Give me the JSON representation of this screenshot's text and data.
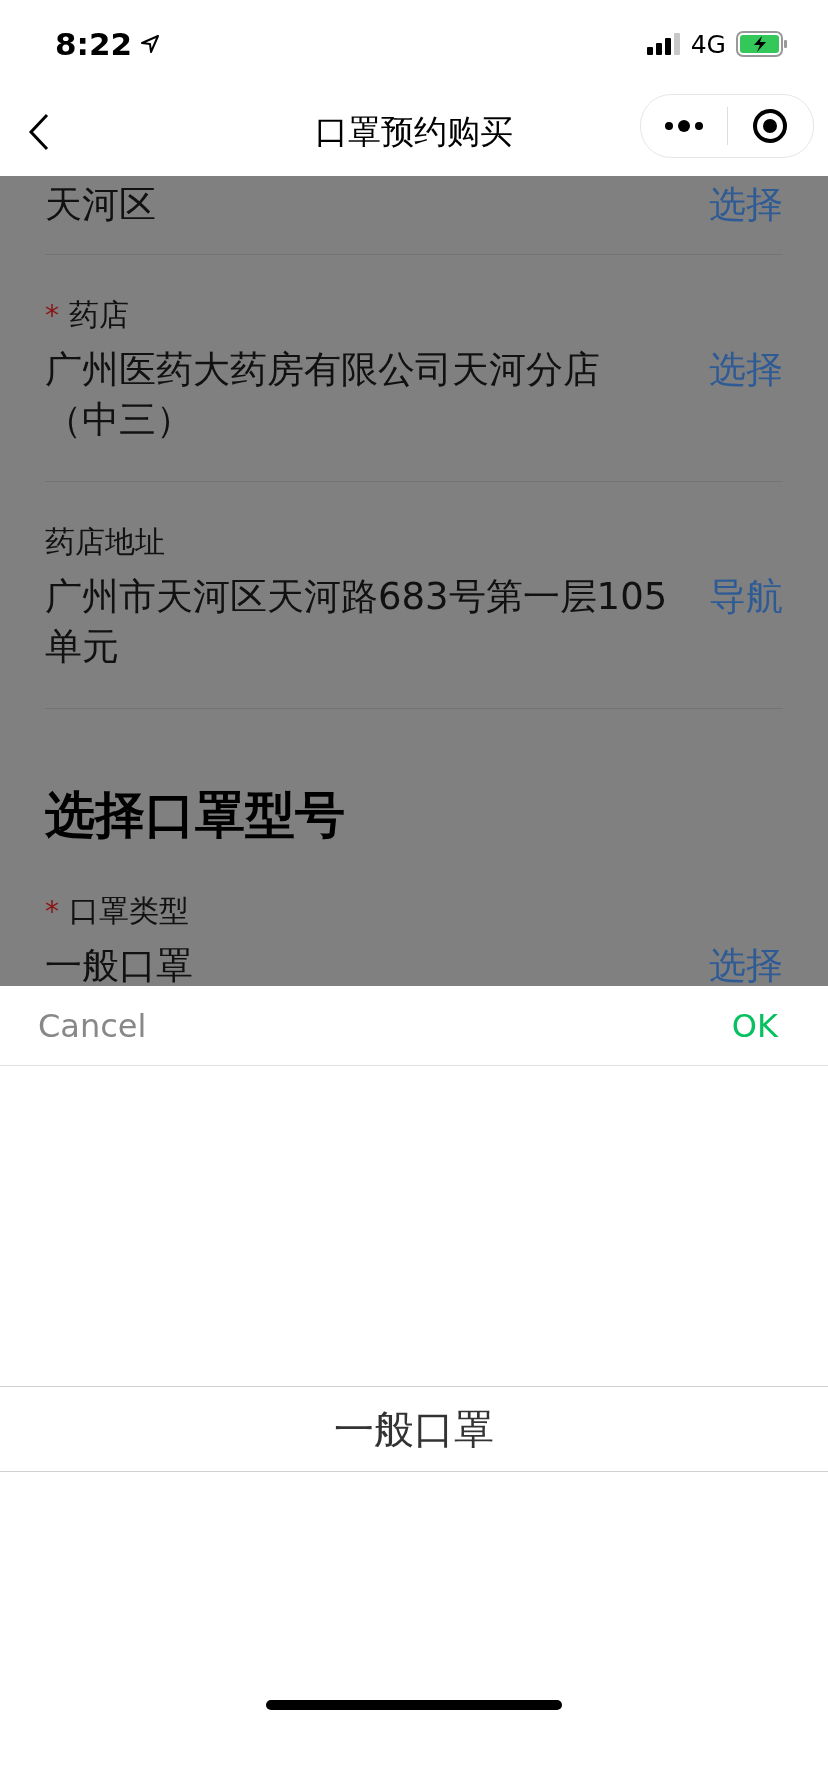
{
  "status_bar": {
    "time": "8:22",
    "network": "4G"
  },
  "nav_bar": {
    "title": "口罩预约购买"
  },
  "form": {
    "rows": [
      {
        "value": "天河区",
        "action": "选择"
      },
      {
        "marker": "*",
        "label": "药店",
        "value": "广州医药大药房有限公司天河分店（中三）",
        "action": "选择"
      },
      {
        "label": "药店地址",
        "value": "广州市天河区天河路683号第一层105单元",
        "action": "导航"
      }
    ],
    "section_title": "选择口罩型号",
    "section_rows": [
      {
        "marker": "*",
        "label": "口罩类型",
        "value": "一般口罩",
        "action": "选择"
      }
    ]
  },
  "picker": {
    "cancel": "Cancel",
    "ok": "OK",
    "options": [
      {
        "label": "一般口罩",
        "selected": true
      }
    ]
  }
}
